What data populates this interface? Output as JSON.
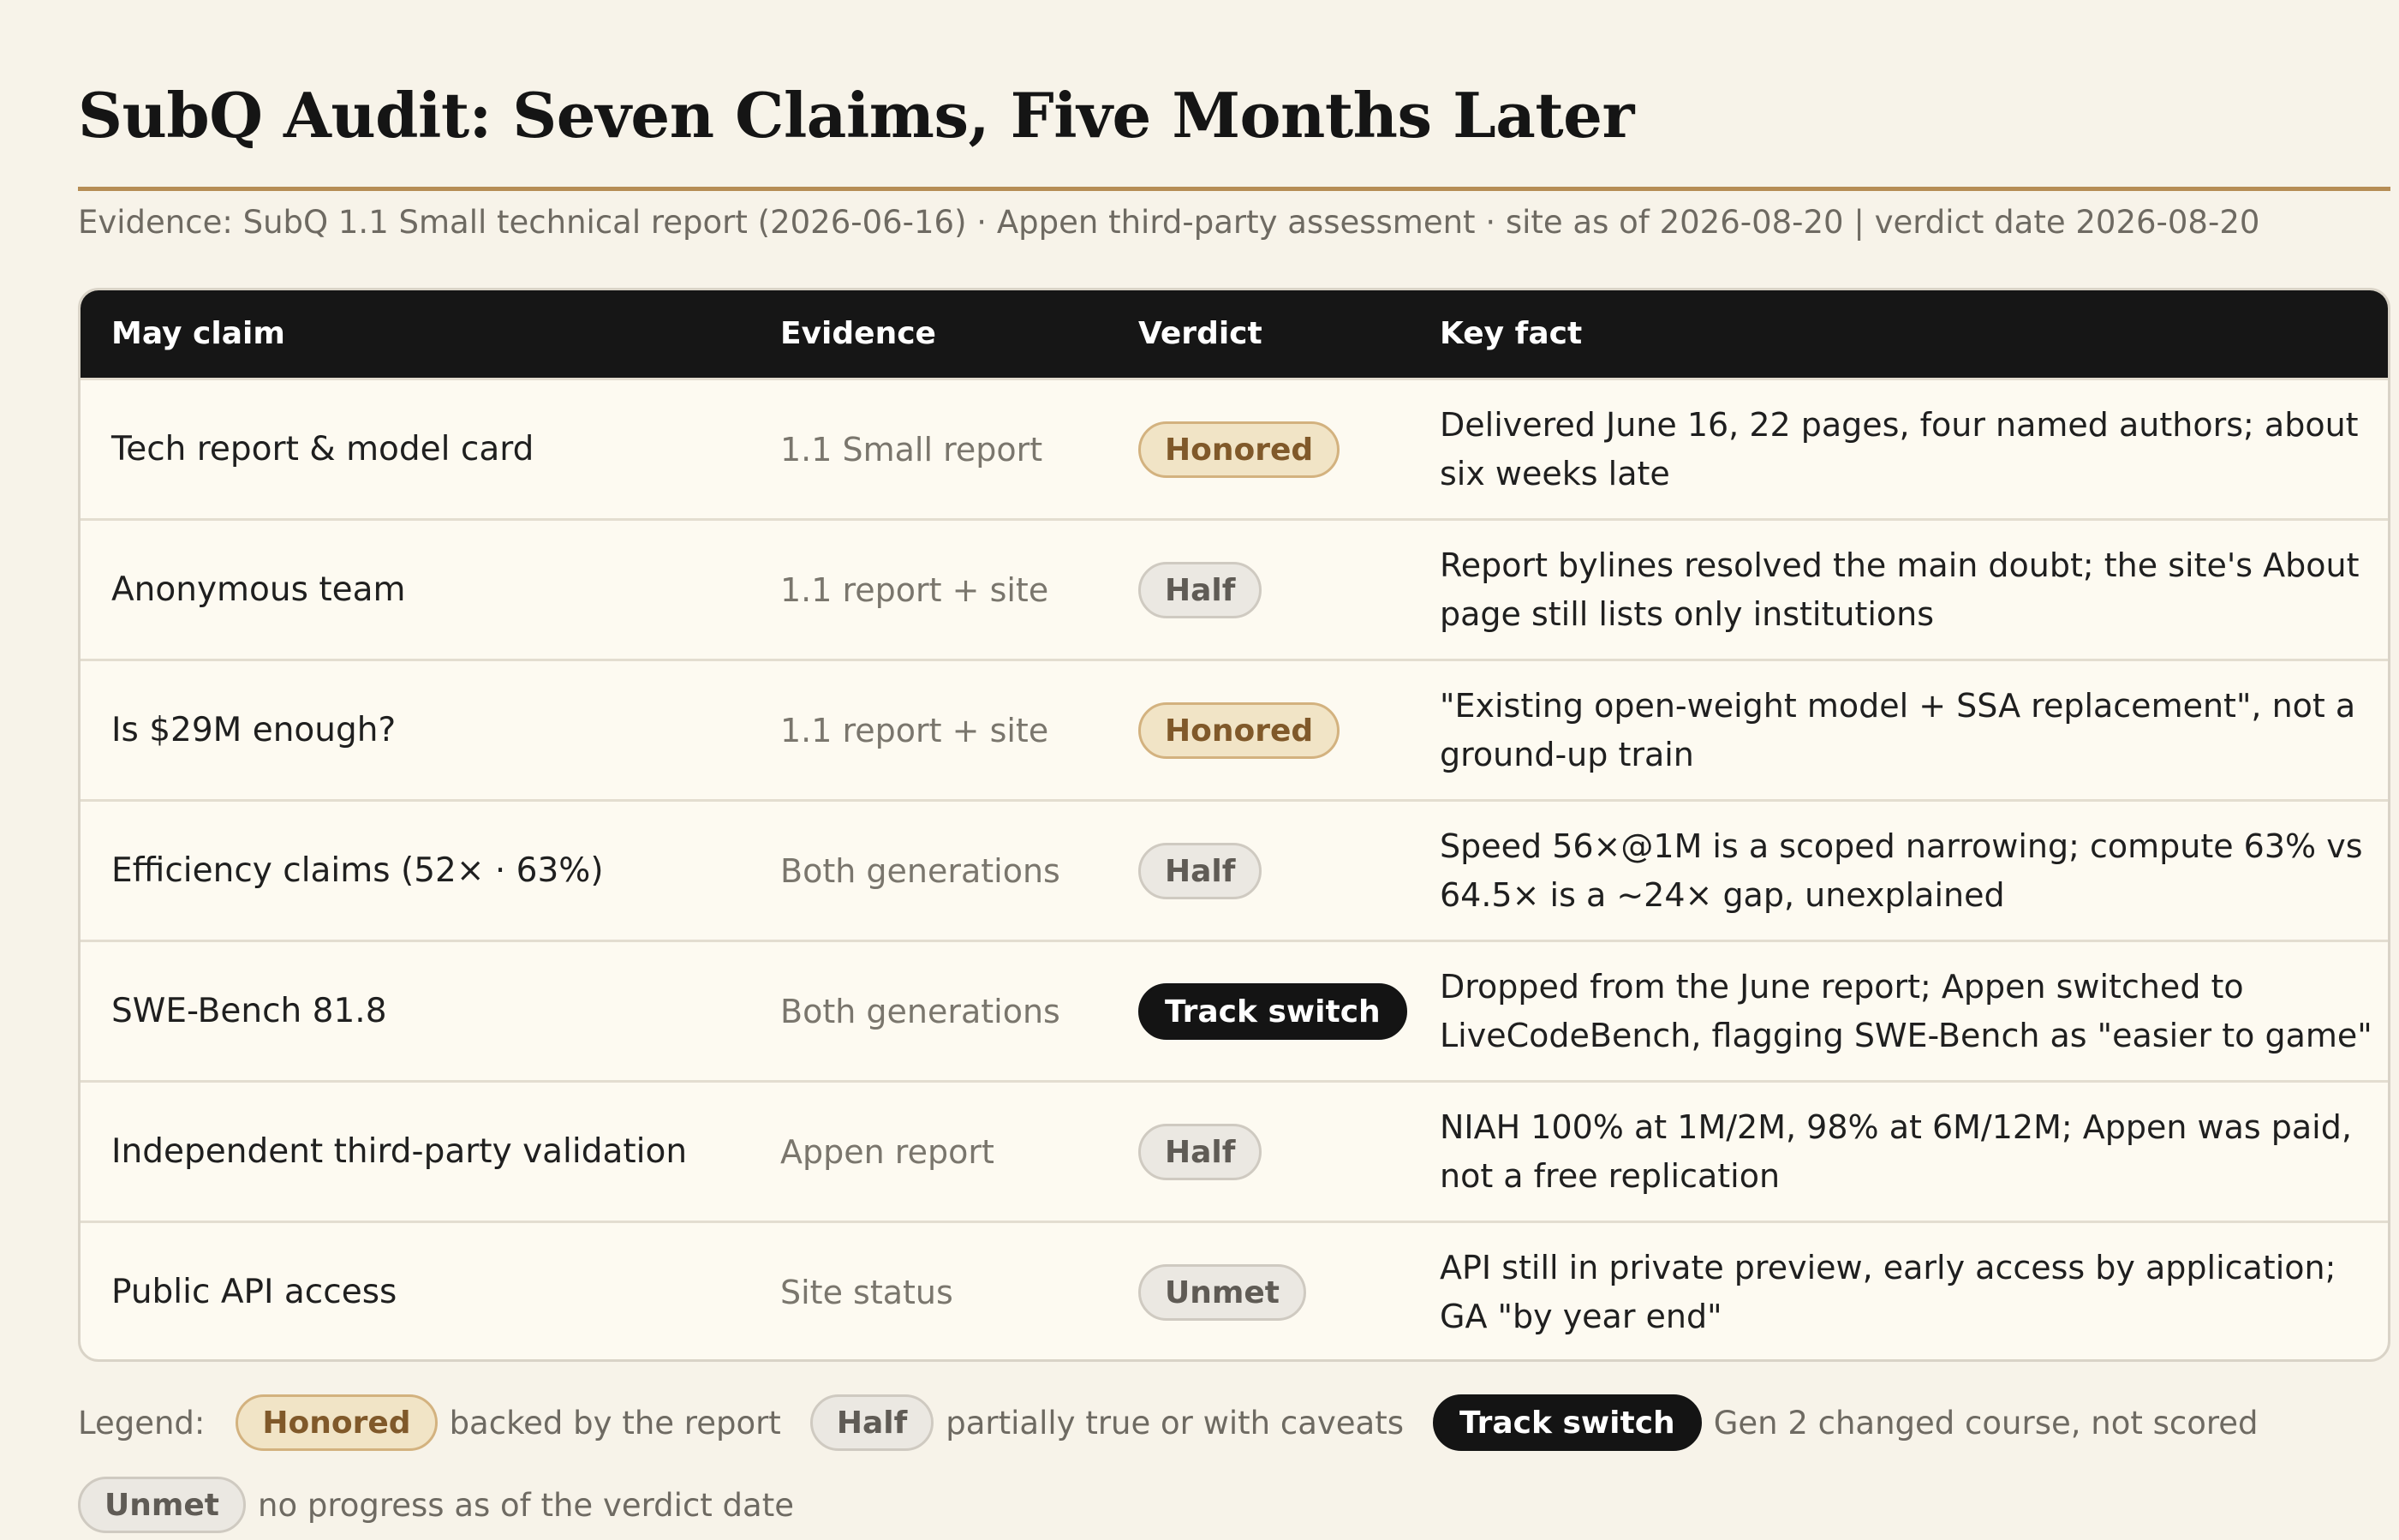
{
  "title": "SubQ Audit: Seven Claims, Five Months Later",
  "subtitle": "Evidence: SubQ 1.1 Small technical report (2026-06-16) · Appen third-party assessment · site as of 2026-08-20 | verdict date 2026-08-20",
  "table": {
    "headers": [
      "May claim",
      "Evidence",
      "Verdict",
      "Key fact"
    ],
    "rows": [
      {
        "claim": "Tech report & model card",
        "evidence": "1.1 Small report",
        "verdict": "Honored",
        "fact": "Delivered June 16, 22 pages, four named authors; about six weeks late"
      },
      {
        "claim": "Anonymous team",
        "evidence": "1.1 report + site",
        "verdict": "Half",
        "fact": "Report bylines resolved the main doubt; the site's About page still lists only institutions"
      },
      {
        "claim": "Is $29M enough?",
        "evidence": "1.1 report + site",
        "verdict": "Honored",
        "fact": "\"Existing open-weight model + SSA replacement\", not a ground-up train"
      },
      {
        "claim": "Efficiency claims (52× · 63%)",
        "evidence": "Both generations",
        "verdict": "Half",
        "fact": "Speed 56×@1M is a scoped narrowing; compute 63% vs 64.5× is a ~24× gap, unexplained"
      },
      {
        "claim": "SWE-Bench 81.8",
        "evidence": "Both generations",
        "verdict": "Track switch",
        "fact": "Dropped from the June report; Appen switched to LiveCodeBench, flagging SWE-Bench as \"easier to game\""
      },
      {
        "claim": "Independent third-party validation",
        "evidence": "Appen report",
        "verdict": "Half",
        "fact": "NIAH 100% at 1M/2M, 98% at 6M/12M; Appen was paid, not a free replication"
      },
      {
        "claim": "Public API access",
        "evidence": "Site status",
        "verdict": "Unmet",
        "fact": "API still in private preview, early access by application; GA \"by year end\""
      }
    ]
  },
  "legend": {
    "label": "Legend:",
    "items": [
      {
        "badge": "Honored",
        "desc": "backed by the report"
      },
      {
        "badge": "Half",
        "desc": "partially true or with caveats"
      },
      {
        "badge": "Track switch",
        "desc": "Gen 2 changed course, not scored"
      },
      {
        "badge": "Unmet",
        "desc": "no progress as of the verdict date"
      }
    ]
  },
  "colors": {
    "accent_rule": "#b68d55",
    "header_bg": "#161616",
    "honored_bg": "#f1e4c6",
    "half_bg": "#ebe8e2",
    "track_bg": "#141414"
  }
}
